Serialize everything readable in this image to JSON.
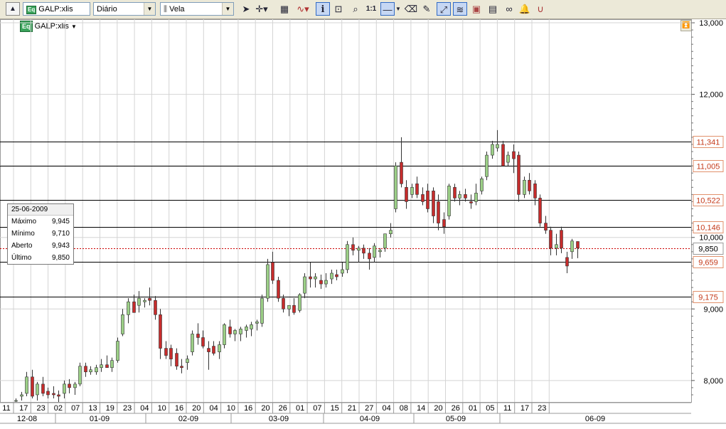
{
  "toolbar": {
    "symbol": "GALP:xlis",
    "symbol_badge": "Eq",
    "period": "Diário",
    "chart_style": "Vela",
    "ratio_label": "1:1",
    "icons": [
      "up-arrow-icon",
      "pointer-icon",
      "crosshair-icon",
      "grid-icon",
      "indicator-icon",
      "info-icon",
      "text-icon",
      "zoom-icon",
      "ratio-icon",
      "horizontal-line-icon",
      "eraser-icon",
      "draw-icon",
      "trend-icon",
      "fibonacci-icon",
      "page-icon",
      "clipboard-icon",
      "link-icon",
      "alarm-icon",
      "magnet-icon"
    ]
  },
  "chart_header": {
    "badge": "Eq",
    "symbol": "GALP:xlis"
  },
  "info_box": {
    "date": "25-06-2009",
    "rows": [
      {
        "label": "Máximo",
        "value": "9,945"
      },
      {
        "label": "Mínimo",
        "value": "9,710"
      },
      {
        "label": "Aberto",
        "value": "9,943"
      },
      {
        "label": "Último",
        "value": "9,850"
      }
    ]
  },
  "chart_data": {
    "type": "candlestick",
    "symbol": "GALP:xlis",
    "ylim": [
      7.7,
      13.05
    ],
    "y_ticks": [
      {
        "value": 8,
        "label": "8,000"
      },
      {
        "value": 9,
        "label": "9,000"
      },
      {
        "value": 10,
        "label": "10,000"
      },
      {
        "value": 11,
        "label": "11,000"
      },
      {
        "value": 12,
        "label": "12,000"
      },
      {
        "value": 13,
        "label": "13,000"
      }
    ],
    "horizontal_levels": [
      {
        "value": 11.341,
        "label": "11,341"
      },
      {
        "value": 11.005,
        "label": "11,005"
      },
      {
        "value": 10.522,
        "label": "10,522"
      },
      {
        "value": 10.146,
        "label": "10,146"
      },
      {
        "value": 9.659,
        "label": "9,659"
      },
      {
        "value": 9.175,
        "label": "9,175"
      }
    ],
    "last_price": {
      "value": 9.85,
      "label": "9,850"
    },
    "x_day_labels": [
      "11",
      "17",
      "23",
      "02",
      "07",
      "13",
      "19",
      "23",
      "04",
      "10",
      "16",
      "20",
      "04",
      "10",
      "16",
      "20",
      "26",
      "01",
      "07",
      "15",
      "21",
      "27",
      "04",
      "08",
      "14",
      "20",
      "26",
      "01",
      "05",
      "11",
      "17",
      "23"
    ],
    "x_month_labels": [
      "12-08",
      "01-09",
      "02-09",
      "03-09",
      "04-09",
      "05-09",
      "06-09"
    ],
    "candles": [
      {
        "o": 7.72,
        "h": 7.75,
        "l": 7.7,
        "c": 7.72
      },
      {
        "o": 7.78,
        "h": 7.84,
        "l": 7.72,
        "c": 7.8
      },
      {
        "o": 7.82,
        "h": 8.12,
        "l": 7.78,
        "c": 8.05
      },
      {
        "o": 8.05,
        "h": 8.15,
        "l": 7.75,
        "c": 7.78
      },
      {
        "o": 7.8,
        "h": 7.98,
        "l": 7.72,
        "c": 7.95
      },
      {
        "o": 7.95,
        "h": 8.05,
        "l": 7.78,
        "c": 7.82
      },
      {
        "o": 7.85,
        "h": 7.9,
        "l": 7.75,
        "c": 7.8
      },
      {
        "o": 7.82,
        "h": 7.92,
        "l": 7.75,
        "c": 7.8
      },
      {
        "o": 7.8,
        "h": 7.86,
        "l": 7.7,
        "c": 7.78
      },
      {
        "o": 7.82,
        "h": 8.0,
        "l": 7.75,
        "c": 7.95
      },
      {
        "o": 7.95,
        "h": 8.02,
        "l": 7.82,
        "c": 7.9
      },
      {
        "o": 7.9,
        "h": 7.98,
        "l": 7.8,
        "c": 7.95
      },
      {
        "o": 7.95,
        "h": 8.25,
        "l": 7.92,
        "c": 8.2
      },
      {
        "o": 8.2,
        "h": 8.25,
        "l": 8.05,
        "c": 8.12
      },
      {
        "o": 8.12,
        "h": 8.2,
        "l": 8.08,
        "c": 8.15
      },
      {
        "o": 8.12,
        "h": 8.22,
        "l": 8.08,
        "c": 8.18
      },
      {
        "o": 8.18,
        "h": 8.3,
        "l": 8.12,
        "c": 8.22
      },
      {
        "o": 8.22,
        "h": 8.35,
        "l": 8.18,
        "c": 8.18
      },
      {
        "o": 8.18,
        "h": 8.32,
        "l": 8.12,
        "c": 8.28
      },
      {
        "o": 8.28,
        "h": 8.6,
        "l": 8.25,
        "c": 8.55
      },
      {
        "o": 8.65,
        "h": 9.0,
        "l": 8.62,
        "c": 8.92
      },
      {
        "o": 8.92,
        "h": 9.15,
        "l": 8.8,
        "c": 9.1
      },
      {
        "o": 9.1,
        "h": 9.2,
        "l": 9.0,
        "c": 8.95
      },
      {
        "o": 9.05,
        "h": 9.25,
        "l": 8.95,
        "c": 9.15
      },
      {
        "o": 9.1,
        "h": 9.15,
        "l": 9.02,
        "c": 9.12
      },
      {
        "o": 9.15,
        "h": 9.3,
        "l": 9.05,
        "c": 9.12
      },
      {
        "o": 9.12,
        "h": 9.18,
        "l": 8.85,
        "c": 8.92
      },
      {
        "o": 8.92,
        "h": 9.0,
        "l": 8.3,
        "c": 8.45
      },
      {
        "o": 8.45,
        "h": 8.55,
        "l": 8.3,
        "c": 8.35
      },
      {
        "o": 8.45,
        "h": 8.5,
        "l": 8.2,
        "c": 8.3
      },
      {
        "o": 8.38,
        "h": 8.45,
        "l": 8.15,
        "c": 8.2
      },
      {
        "o": 8.2,
        "h": 8.3,
        "l": 8.1,
        "c": 8.18
      },
      {
        "o": 8.25,
        "h": 8.35,
        "l": 8.15,
        "c": 8.3
      },
      {
        "o": 8.4,
        "h": 8.7,
        "l": 8.35,
        "c": 8.65
      },
      {
        "o": 8.65,
        "h": 8.8,
        "l": 8.5,
        "c": 8.6
      },
      {
        "o": 8.6,
        "h": 8.7,
        "l": 8.45,
        "c": 8.48
      },
      {
        "o": 8.45,
        "h": 8.55,
        "l": 8.15,
        "c": 8.4
      },
      {
        "o": 8.48,
        "h": 8.55,
        "l": 8.35,
        "c": 8.38
      },
      {
        "o": 8.4,
        "h": 8.55,
        "l": 8.3,
        "c": 8.5
      },
      {
        "o": 8.5,
        "h": 8.8,
        "l": 8.45,
        "c": 8.78
      },
      {
        "o": 8.75,
        "h": 8.85,
        "l": 8.6,
        "c": 8.65
      },
      {
        "o": 8.65,
        "h": 8.72,
        "l": 8.55,
        "c": 8.7
      },
      {
        "o": 8.65,
        "h": 8.75,
        "l": 8.55,
        "c": 8.72
      },
      {
        "o": 8.7,
        "h": 8.78,
        "l": 8.6,
        "c": 8.75
      },
      {
        "o": 8.72,
        "h": 8.82,
        "l": 8.62,
        "c": 8.78
      },
      {
        "o": 8.8,
        "h": 8.85,
        "l": 8.7,
        "c": 8.82
      },
      {
        "o": 8.8,
        "h": 9.2,
        "l": 8.75,
        "c": 9.15
      },
      {
        "o": 9.15,
        "h": 9.7,
        "l": 9.1,
        "c": 9.62
      },
      {
        "o": 9.65,
        "h": 9.8,
        "l": 9.35,
        "c": 9.4
      },
      {
        "o": 9.4,
        "h": 9.45,
        "l": 9.1,
        "c": 9.15
      },
      {
        "o": 9.15,
        "h": 9.2,
        "l": 8.95,
        "c": 9.0
      },
      {
        "o": 9.0,
        "h": 9.05,
        "l": 8.9,
        "c": 9.05
      },
      {
        "o": 9.05,
        "h": 9.15,
        "l": 8.92,
        "c": 8.95
      },
      {
        "o": 8.98,
        "h": 9.22,
        "l": 8.95,
        "c": 9.2
      },
      {
        "o": 9.22,
        "h": 9.5,
        "l": 9.15,
        "c": 9.45
      },
      {
        "o": 9.45,
        "h": 9.65,
        "l": 9.3,
        "c": 9.42
      },
      {
        "o": 9.42,
        "h": 9.5,
        "l": 9.3,
        "c": 9.45
      },
      {
        "o": 9.4,
        "h": 9.48,
        "l": 9.28,
        "c": 9.35
      },
      {
        "o": 9.35,
        "h": 9.5,
        "l": 9.3,
        "c": 9.4
      },
      {
        "o": 9.42,
        "h": 9.55,
        "l": 9.35,
        "c": 9.5
      },
      {
        "o": 9.48,
        "h": 9.55,
        "l": 9.4,
        "c": 9.45
      },
      {
        "o": 9.5,
        "h": 9.65,
        "l": 9.45,
        "c": 9.55
      },
      {
        "o": 9.55,
        "h": 9.95,
        "l": 9.5,
        "c": 9.9
      },
      {
        "o": 9.9,
        "h": 10.0,
        "l": 9.75,
        "c": 9.82
      },
      {
        "o": 9.82,
        "h": 9.88,
        "l": 9.65,
        "c": 9.85
      },
      {
        "o": 9.85,
        "h": 9.9,
        "l": 9.7,
        "c": 9.78
      },
      {
        "o": 9.78,
        "h": 9.85,
        "l": 9.55,
        "c": 9.7
      },
      {
        "o": 9.72,
        "h": 9.92,
        "l": 9.65,
        "c": 9.88
      },
      {
        "o": 9.8,
        "h": 9.85,
        "l": 9.72,
        "c": 9.82
      },
      {
        "o": 9.85,
        "h": 10.05,
        "l": 9.8,
        "c": 10.05
      },
      {
        "o": 10.05,
        "h": 10.2,
        "l": 10.0,
        "c": 10.1
      },
      {
        "o": 10.4,
        "h": 11.05,
        "l": 10.35,
        "c": 11.0
      },
      {
        "o": 11.05,
        "h": 11.4,
        "l": 10.7,
        "c": 10.75
      },
      {
        "o": 10.7,
        "h": 10.8,
        "l": 10.4,
        "c": 10.5
      },
      {
        "o": 10.6,
        "h": 10.75,
        "l": 10.55,
        "c": 10.7
      },
      {
        "o": 10.75,
        "h": 10.85,
        "l": 10.55,
        "c": 10.6
      },
      {
        "o": 10.6,
        "h": 10.7,
        "l": 10.45,
        "c": 10.5
      },
      {
        "o": 10.65,
        "h": 10.75,
        "l": 10.35,
        "c": 10.4
      },
      {
        "o": 10.65,
        "h": 10.7,
        "l": 10.2,
        "c": 10.3
      },
      {
        "o": 10.5,
        "h": 10.6,
        "l": 10.1,
        "c": 10.2
      },
      {
        "o": 10.25,
        "h": 10.35,
        "l": 10.05,
        "c": 10.15
      },
      {
        "o": 10.3,
        "h": 10.75,
        "l": 10.25,
        "c": 10.72
      },
      {
        "o": 10.7,
        "h": 10.75,
        "l": 10.5,
        "c": 10.55
      },
      {
        "o": 10.55,
        "h": 10.65,
        "l": 10.45,
        "c": 10.6
      },
      {
        "o": 10.6,
        "h": 10.68,
        "l": 10.5,
        "c": 10.55
      },
      {
        "o": 10.5,
        "h": 10.6,
        "l": 10.4,
        "c": 10.48
      },
      {
        "o": 10.5,
        "h": 10.75,
        "l": 10.45,
        "c": 10.62
      },
      {
        "o": 10.65,
        "h": 10.85,
        "l": 10.6,
        "c": 10.82
      },
      {
        "o": 10.85,
        "h": 11.2,
        "l": 10.8,
        "c": 11.15
      },
      {
        "o": 11.15,
        "h": 11.35,
        "l": 11.1,
        "c": 11.3
      },
      {
        "o": 11.25,
        "h": 11.5,
        "l": 11.2,
        "c": 11.3
      },
      {
        "o": 11.3,
        "h": 11.35,
        "l": 11.0,
        "c": 11.0
      },
      {
        "o": 11.05,
        "h": 11.2,
        "l": 11.0,
        "c": 11.15
      },
      {
        "o": 11.2,
        "h": 11.3,
        "l": 10.9,
        "c": 11.1
      },
      {
        "o": 11.15,
        "h": 11.2,
        "l": 10.5,
        "c": 10.6
      },
      {
        "o": 10.6,
        "h": 10.85,
        "l": 10.55,
        "c": 10.8
      },
      {
        "o": 10.8,
        "h": 10.9,
        "l": 10.6,
        "c": 10.65
      },
      {
        "o": 10.75,
        "h": 10.8,
        "l": 10.45,
        "c": 10.55
      },
      {
        "o": 10.55,
        "h": 10.6,
        "l": 10.15,
        "c": 10.2
      },
      {
        "o": 10.2,
        "h": 10.3,
        "l": 10.05,
        "c": 10.1
      },
      {
        "o": 10.1,
        "h": 10.15,
        "l": 9.75,
        "c": 9.85
      },
      {
        "o": 9.85,
        "h": 10.05,
        "l": 9.75,
        "c": 9.9
      },
      {
        "o": 10.1,
        "h": 10.15,
        "l": 9.78,
        "c": 9.85
      },
      {
        "o": 9.72,
        "h": 9.8,
        "l": 9.5,
        "c": 9.6
      },
      {
        "o": 9.8,
        "h": 9.98,
        "l": 9.7,
        "c": 9.95
      },
      {
        "o": 9.943,
        "h": 9.945,
        "l": 9.71,
        "c": 9.85
      }
    ],
    "colors": {
      "up": "#9bcf86",
      "down": "#c62c2c",
      "outline": "#333333",
      "level_line": "#000000",
      "level_label_text": "#c43a1a",
      "level_label_border": "#e2916c",
      "last_price_line": "#cc0000",
      "grid": "#d4d4d4"
    }
  }
}
